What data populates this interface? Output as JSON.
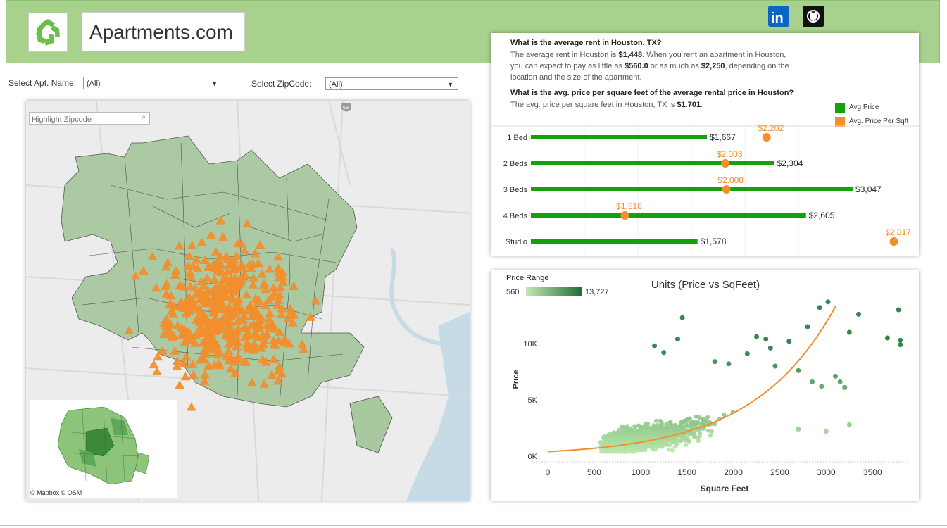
{
  "header": {
    "site_title": "Apartments.com",
    "logo_icon": "apartments-logo-icon",
    "social": [
      {
        "name": "linkedin-icon",
        "label": "in"
      },
      {
        "name": "github-icon",
        "label": ""
      }
    ]
  },
  "filters": {
    "apt_label": "Select Apt. Name:",
    "apt_value": "(All)",
    "zip_label": "Select ZipCode:",
    "zip_value": "(All)"
  },
  "map": {
    "search_placeholder": "Highlight Zipcode",
    "attribution": "© Mapbox © OSM",
    "highway_label": "69",
    "colors": {
      "zone": "#a8c8a0",
      "marker": "#f28e2b",
      "water": "#c7dbe6"
    }
  },
  "info": {
    "q1": "What is the average rent in Houston, TX?",
    "a1_pre": "The average rent in Houston is ",
    "a1_avg": "$1,448",
    "a1_mid": ". When you rent an apartment in Houston, you can expect to pay as little as ",
    "a1_min": "$560.0",
    "a1_mid2": " or as much as ",
    "a1_max": "$2,250",
    "a1_post": ", depending on the location and the size of the apartment.",
    "q2": "What is the avg. price per square feet of the average rental price in Houston?",
    "a2_pre": "The avg. price per square feet  in Houston, TX is ",
    "a2_val": "$1.701",
    "a2_post": "."
  },
  "chart_data": [
    {
      "type": "bar",
      "legend": [
        {
          "label": "Avg Price",
          "color": "#13a10e"
        },
        {
          "label": "Avg. Price Per Sqft",
          "color": "#f28e2b"
        }
      ],
      "categories": [
        "1 Bed",
        "2 Beds",
        "3 Beds",
        "4 Beds",
        "Studio"
      ],
      "series": [
        {
          "name": "Avg Price",
          "values": [
            1667,
            2304,
            3047,
            2605,
            1578
          ],
          "labels": [
            "$1,667",
            "$2,304",
            "$3,047",
            "$2,605",
            "$1,578"
          ]
        },
        {
          "name": "Avg. Price Per Sqft",
          "values": [
            2.202,
            2.003,
            2.008,
            1.518,
            2.817
          ],
          "labels": [
            "$2.202",
            "$2.003",
            "$2.008",
            "$1.518",
            "$2.817"
          ]
        }
      ]
    },
    {
      "type": "scatter",
      "title": "Units (Price vs SqFeet)",
      "xlabel": "Square Feet",
      "ylabel": "Price",
      "xlim": [
        0,
        3900
      ],
      "ylim": [
        0,
        14000
      ],
      "xticks": [
        "0",
        "500",
        "1000",
        "1500",
        "2000",
        "2500",
        "3000",
        "3500"
      ],
      "yticks": [
        "0K",
        "5K",
        "10K"
      ],
      "legend": {
        "title": "Price Range",
        "min": "560",
        "max": "13,727"
      },
      "colors": {
        "low": "#b8e3a8",
        "high": "#1f7a3a",
        "trend": "#f28e2b"
      },
      "outliers": [
        {
          "x": 2930,
          "y": 13200
        },
        {
          "x": 3020,
          "y": 13700
        },
        {
          "x": 2800,
          "y": 11500
        },
        {
          "x": 3350,
          "y": 12600
        },
        {
          "x": 3780,
          "y": 13000
        },
        {
          "x": 3250,
          "y": 11000
        },
        {
          "x": 3800,
          "y": 9900
        },
        {
          "x": 3800,
          "y": 10300
        },
        {
          "x": 3660,
          "y": 10500
        },
        {
          "x": 3100,
          "y": 7100
        },
        {
          "x": 3150,
          "y": 6600
        },
        {
          "x": 3200,
          "y": 6100
        },
        {
          "x": 2850,
          "y": 6600
        },
        {
          "x": 2950,
          "y": 6200
        },
        {
          "x": 2450,
          "y": 8000
        },
        {
          "x": 2700,
          "y": 7600
        },
        {
          "x": 1450,
          "y": 12300
        },
        {
          "x": 1400,
          "y": 10400
        },
        {
          "x": 1150,
          "y": 9800
        },
        {
          "x": 1250,
          "y": 9200
        },
        {
          "x": 2250,
          "y": 10600
        },
        {
          "x": 2400,
          "y": 9600
        },
        {
          "x": 2350,
          "y": 10400
        },
        {
          "x": 1800,
          "y": 8400
        },
        {
          "x": 1950,
          "y": 8200
        },
        {
          "x": 2600,
          "y": 10200
        },
        {
          "x": 2150,
          "y": 9100
        },
        {
          "x": 3250,
          "y": 2800
        },
        {
          "x": 3000,
          "y": 2200
        },
        {
          "x": 2700,
          "y": 2400
        }
      ]
    }
  ]
}
